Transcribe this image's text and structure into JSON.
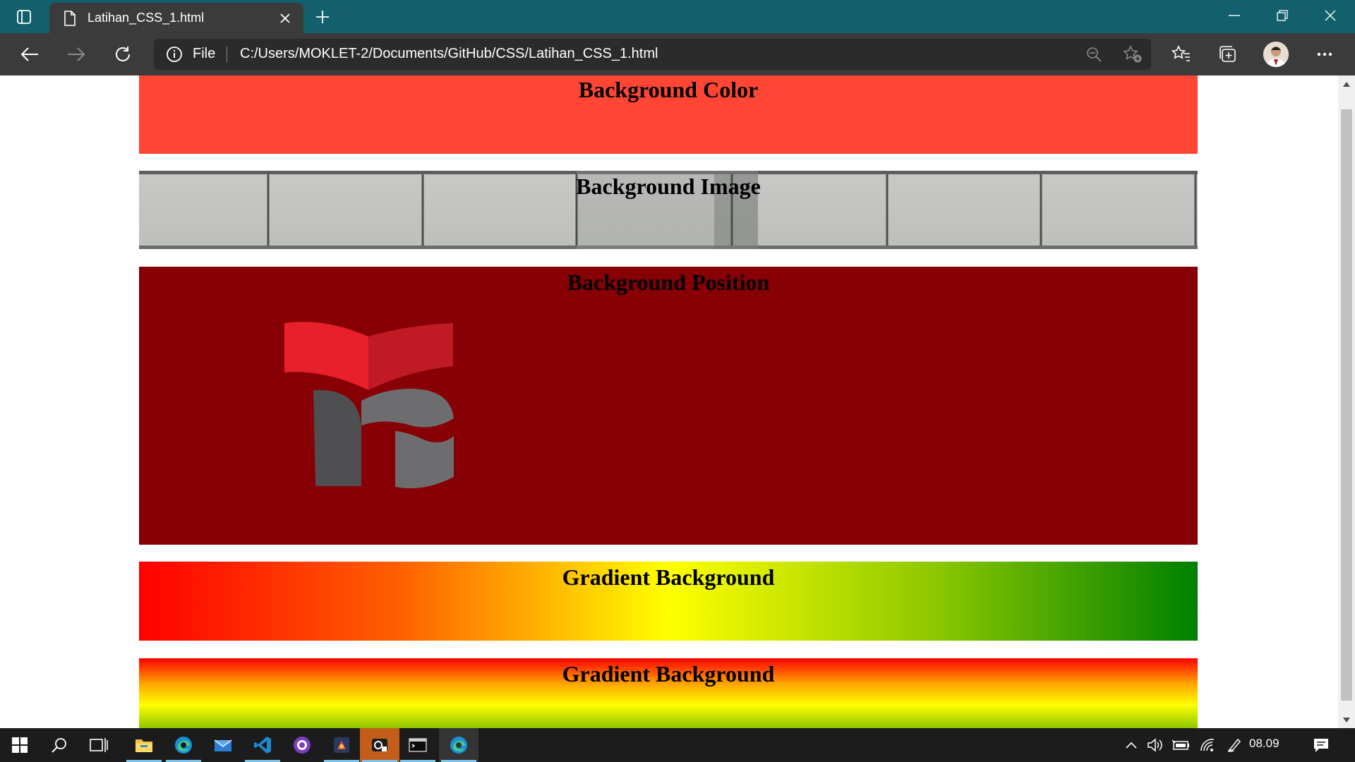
{
  "browser": {
    "tab": {
      "title": "Latihan_CSS_1.html"
    },
    "address": {
      "scheme_label": "File",
      "url": "C:/Users/MOKLET-2/Documents/GitHub/CSS/Latihan_CSS_1.html"
    },
    "icons": [
      "tab-actions-icon",
      "page-icon",
      "close-icon",
      "plus-icon",
      "minimize-icon",
      "restore-icon",
      "close-window-icon",
      "back-icon",
      "forward-icon",
      "refresh-icon",
      "info-icon",
      "zoom-out-icon",
      "add-favorite-icon",
      "favorites-icon",
      "collections-icon",
      "profile-avatar",
      "more-icon"
    ]
  },
  "page": {
    "sections": [
      {
        "heading": "Background Color",
        "background": "#ff4635"
      },
      {
        "heading": "Background Image",
        "background": "brick-wall-image"
      },
      {
        "heading": "Background Position",
        "background": "#860006"
      },
      {
        "heading": "Gradient Background",
        "gradient": [
          "#ff0000",
          "#ffff00",
          "#008000"
        ],
        "direction": "to right"
      },
      {
        "heading": "Gradient Background",
        "gradient": [
          "#ff0000",
          "#ffff00",
          "#3c9600"
        ],
        "direction": "to bottom"
      }
    ]
  },
  "taskbar": {
    "apps": [
      "start-icon",
      "search-icon",
      "task-view-icon",
      "file-explorer-icon",
      "edge-icon",
      "mail-icon",
      "vscode-icon",
      "github-desktop-icon",
      "app-icon",
      "app-icon",
      "terminal-icon",
      "edge-icon"
    ],
    "tray_icons": [
      "chevron-up-icon",
      "volume-icon",
      "battery-icon",
      "wifi-icon",
      "pen-icon",
      "notification-icon"
    ],
    "clock": "08.09"
  },
  "colors": {
    "titlebar": "#11606b",
    "toolbar": "#3b3b3b",
    "taskbar": "#1c1c1c"
  }
}
